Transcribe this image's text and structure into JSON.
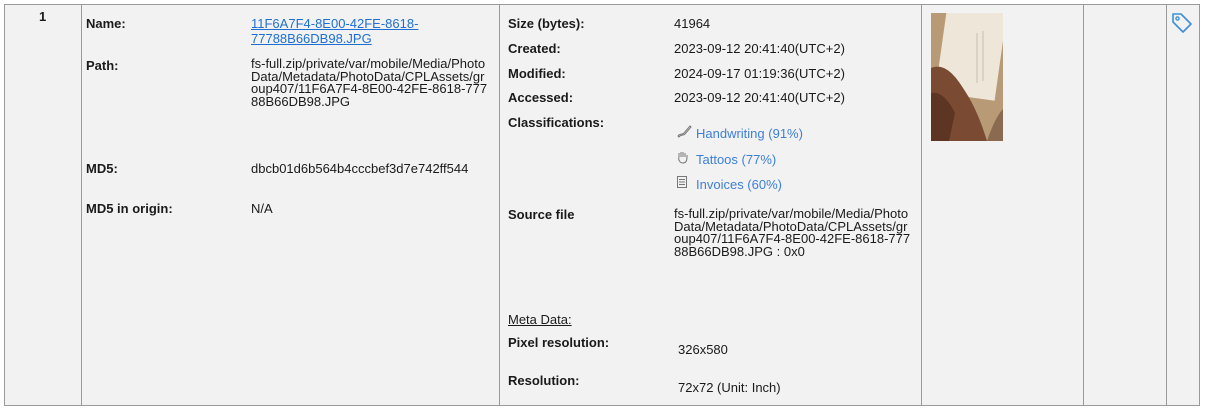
{
  "row_index": "1",
  "file": {
    "name_label": "Name:",
    "name_value_line1": "11F6A7F4-8E00-42FE-8618-",
    "name_value_line2": "77788B66DB98.JPG",
    "path_label": "Path:",
    "path_value": "fs-full.zip/private/var/mobile/Media/PhotoData/Metadata/PhotoData/CPLAssets/group407/11F6A7F4-8E00-42FE-8618-77788B66DB98.JPG",
    "md5_label": "MD5:",
    "md5_value": "dbcb01d6b564b4cccbef3d7e742ff544",
    "md5_origin_label": "MD5 in origin:",
    "md5_origin_value": "N/A"
  },
  "details": {
    "size_label": "Size (bytes):",
    "size_value": "41964",
    "created_label": "Created:",
    "created_value": "2023-09-12 20:41:40(UTC+2)",
    "modified_label": "Modified:",
    "modified_value": "2024-09-17 01:19:36(UTC+2)",
    "accessed_label": "Accessed:",
    "accessed_value": "2023-09-12 20:41:40(UTC+2)",
    "classifications_label": "Classifications:",
    "classifications": [
      {
        "label": "Handwriting (91%)",
        "icon": "pen-icon"
      },
      {
        "label": "Tattoos (77%)",
        "icon": "hand-icon"
      },
      {
        "label": "Invoices (60%)",
        "icon": "document-icon"
      }
    ],
    "source_label": "Source file",
    "source_value": "fs-full.zip/private/var/mobile/Media/PhotoData/Metadata/PhotoData/CPLAssets/group407/11F6A7F4-8E00-42FE-8618-77788B66DB98.JPG : 0x0",
    "meta_label": "Meta Data:",
    "pixel_res_label": "Pixel resolution:",
    "pixel_res_value": "326x580",
    "resolution_label": "Resolution:",
    "resolution_value": "72x72 (Unit: Inch)"
  },
  "colors": {
    "link": "#1f6fd1",
    "classification": "#3d7fd6",
    "row_background": "#f2f2f2",
    "border": "#9a9a9a"
  },
  "icons": {
    "tag": "tag-icon"
  }
}
